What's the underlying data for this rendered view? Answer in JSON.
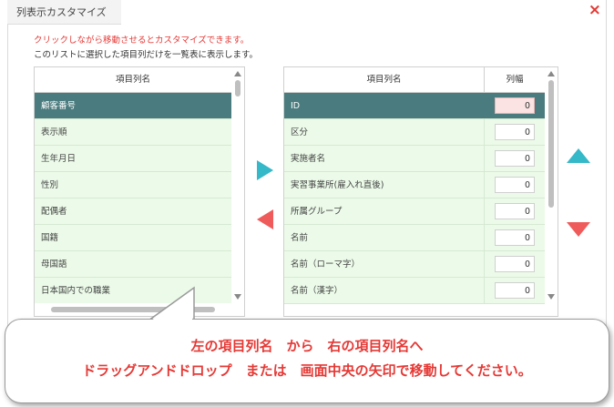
{
  "dialog": {
    "tab_title": "列表示カスタマイズ",
    "close_icon": "×",
    "instruction_red": "クリックしながら移動させるとカスタマイズできます。",
    "instruction": "このリストに選択した項目列だけを一覧表に表示します。"
  },
  "left_list": {
    "header": "項目列名",
    "items": [
      "顧客番号",
      "表示順",
      "生年月日",
      "性別",
      "配偶者",
      "国籍",
      "母国語",
      "日本国内での職業"
    ],
    "selected_index": 0
  },
  "right_list": {
    "header_name": "項目列名",
    "header_width": "列幅",
    "rows": [
      {
        "name": "ID",
        "width": "0"
      },
      {
        "name": "区分",
        "width": "0"
      },
      {
        "name": "実施者名",
        "width": "0"
      },
      {
        "name": "実習事業所(雇入れ直後)",
        "width": "0"
      },
      {
        "name": "所属グループ",
        "width": "0"
      },
      {
        "name": "名前",
        "width": "0"
      },
      {
        "name": "名前（ローマ字）",
        "width": "0"
      },
      {
        "name": "名前（漢字）",
        "width": "0"
      }
    ],
    "selected_index": 0
  },
  "colors": {
    "selected_row": "#4a7b7e",
    "row_bg": "#ecfbe9",
    "arrow_teal": "#35b8c8",
    "arrow_red": "#ef5b5b",
    "accent_red": "#e53935"
  },
  "icons": {
    "move_right": "arrow-right-icon",
    "move_left": "arrow-left-icon",
    "move_up": "arrow-up-icon",
    "move_down": "arrow-down-icon"
  },
  "callout": {
    "line1": "左の項目列名　から　右の項目列名へ",
    "line2": "ドラッグアンドドロップ　または　画面中央の矢印で移動してください。"
  }
}
